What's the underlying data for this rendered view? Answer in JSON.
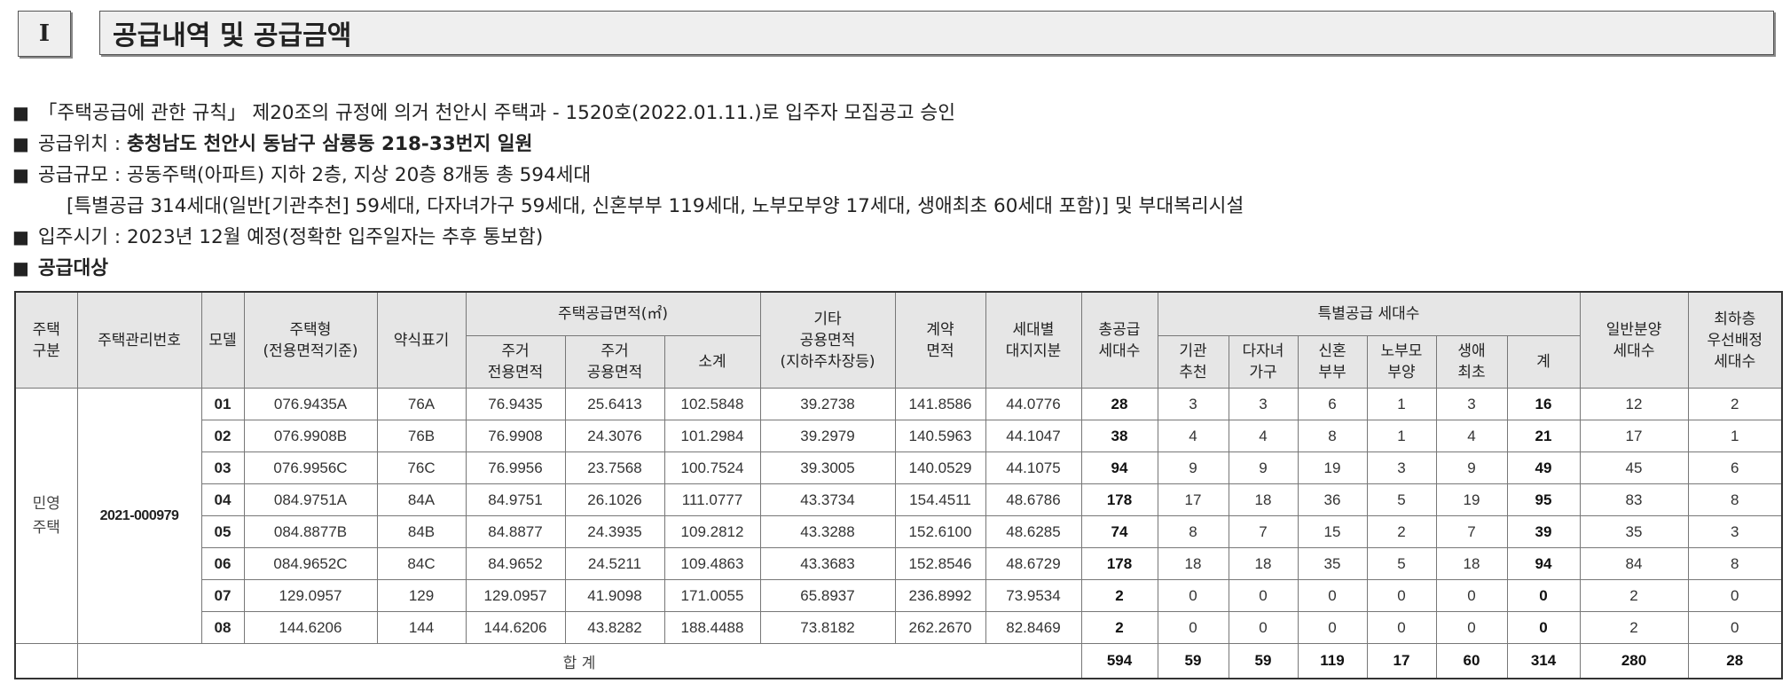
{
  "section": {
    "number": "I",
    "title": "공급내역 및 공급금액"
  },
  "notices": {
    "approval": "「주택공급에 관한 규칙」 제20조의 규정에 의거 천안시 주택과 - 1520호(2022.01.11.)로 입주자 모집공고 승인",
    "location_label": "공급위치 : ",
    "location_value": "충청남도 천안시 동남구 삼룡동 218-33번지 일원",
    "scale": "공급규모 : 공동주택(아파트) 지하 2층, 지상 20층 8개동 총 594세대",
    "scale_detail": "[특별공급 314세대(일반[기관추천] 59세대, 다자녀가구 59세대, 신혼부부 119세대, 노부모부양 17세대, 생애최초 60세대 포함)] 및 부대복리시설",
    "move_in": "입주시기 : 2023년 12월 예정(정확한 입주일자는 추후 통보함)",
    "target": "공급대상",
    "bullet": "■"
  },
  "table": {
    "headers": {
      "type": [
        "주택",
        "구분"
      ],
      "mgmt_no": "주택관리번호",
      "model": "모델",
      "housing_type": [
        "주택형",
        "(전용면적기준)"
      ],
      "abbr": "약식표기",
      "supply_area": "주택공급면적(㎡)",
      "exclusive": [
        "주거",
        "전용면적"
      ],
      "common": [
        "주거",
        "공용면적"
      ],
      "subtotal": "소계",
      "other_common": [
        "기타",
        "공용면적",
        "(지하주차장등)"
      ],
      "contract_area": [
        "계약",
        "면적"
      ],
      "land_share": [
        "세대별",
        "대지지분"
      ],
      "total_units": [
        "총공급",
        "세대수"
      ],
      "special": "특별공급 세대수",
      "institution": [
        "기관",
        "추천"
      ],
      "multi_child": [
        "다자녀",
        "가구"
      ],
      "newlywed": [
        "신혼",
        "부부"
      ],
      "elderly": [
        "노부모",
        "부양"
      ],
      "first_life": [
        "생애",
        "최초"
      ],
      "special_sum": "계",
      "general": [
        "일반분양",
        "세대수"
      ],
      "lowest_floor": [
        "최하층",
        "우선배정",
        "세대수"
      ]
    },
    "category": [
      "민영",
      "주택"
    ],
    "mgmt_no": "2021-000979",
    "rows": [
      {
        "model": "01",
        "type": "076.9435A",
        "abbr": "76A",
        "excl": "76.9435",
        "common": "25.6413",
        "sub": "102.5848",
        "other": "39.2738",
        "contract": "141.8586",
        "land": "44.0776",
        "total": "28",
        "inst": "3",
        "multi": "3",
        "newly": "6",
        "elder": "1",
        "first": "3",
        "sp": "16",
        "gen": "12",
        "low": "2"
      },
      {
        "model": "02",
        "type": "076.9908B",
        "abbr": "76B",
        "excl": "76.9908",
        "common": "24.3076",
        "sub": "101.2984",
        "other": "39.2979",
        "contract": "140.5963",
        "land": "44.1047",
        "total": "38",
        "inst": "4",
        "multi": "4",
        "newly": "8",
        "elder": "1",
        "first": "4",
        "sp": "21",
        "gen": "17",
        "low": "1"
      },
      {
        "model": "03",
        "type": "076.9956C",
        "abbr": "76C",
        "excl": "76.9956",
        "common": "23.7568",
        "sub": "100.7524",
        "other": "39.3005",
        "contract": "140.0529",
        "land": "44.1075",
        "total": "94",
        "inst": "9",
        "multi": "9",
        "newly": "19",
        "elder": "3",
        "first": "9",
        "sp": "49",
        "gen": "45",
        "low": "6"
      },
      {
        "model": "04",
        "type": "084.9751A",
        "abbr": "84A",
        "excl": "84.9751",
        "common": "26.1026",
        "sub": "111.0777",
        "other": "43.3734",
        "contract": "154.4511",
        "land": "48.6786",
        "total": "178",
        "inst": "17",
        "multi": "18",
        "newly": "36",
        "elder": "5",
        "first": "19",
        "sp": "95",
        "gen": "83",
        "low": "8"
      },
      {
        "model": "05",
        "type": "084.8877B",
        "abbr": "84B",
        "excl": "84.8877",
        "common": "24.3935",
        "sub": "109.2812",
        "other": "43.3288",
        "contract": "152.6100",
        "land": "48.6285",
        "total": "74",
        "inst": "8",
        "multi": "7",
        "newly": "15",
        "elder": "2",
        "first": "7",
        "sp": "39",
        "gen": "35",
        "low": "3"
      },
      {
        "model": "06",
        "type": "084.9652C",
        "abbr": "84C",
        "excl": "84.9652",
        "common": "24.5211",
        "sub": "109.4863",
        "other": "43.3683",
        "contract": "152.8546",
        "land": "48.6729",
        "total": "178",
        "inst": "18",
        "multi": "18",
        "newly": "35",
        "elder": "5",
        "first": "18",
        "sp": "94",
        "gen": "84",
        "low": "8"
      },
      {
        "model": "07",
        "type": "129.0957",
        "abbr": "129",
        "excl": "129.0957",
        "common": "41.9098",
        "sub": "171.0055",
        "other": "65.8937",
        "contract": "236.8992",
        "land": "73.9534",
        "total": "2",
        "inst": "0",
        "multi": "0",
        "newly": "0",
        "elder": "0",
        "first": "0",
        "sp": "0",
        "gen": "2",
        "low": "0"
      },
      {
        "model": "08",
        "type": "144.6206",
        "abbr": "144",
        "excl": "144.6206",
        "common": "43.8282",
        "sub": "188.4488",
        "other": "73.8182",
        "contract": "262.2670",
        "land": "82.8469",
        "total": "2",
        "inst": "0",
        "multi": "0",
        "newly": "0",
        "elder": "0",
        "first": "0",
        "sp": "0",
        "gen": "2",
        "low": "0"
      }
    ],
    "totals": {
      "label": "합 계",
      "total": "594",
      "inst": "59",
      "multi": "59",
      "newly": "119",
      "elder": "17",
      "first": "60",
      "sp": "314",
      "gen": "280",
      "low": "28"
    }
  }
}
